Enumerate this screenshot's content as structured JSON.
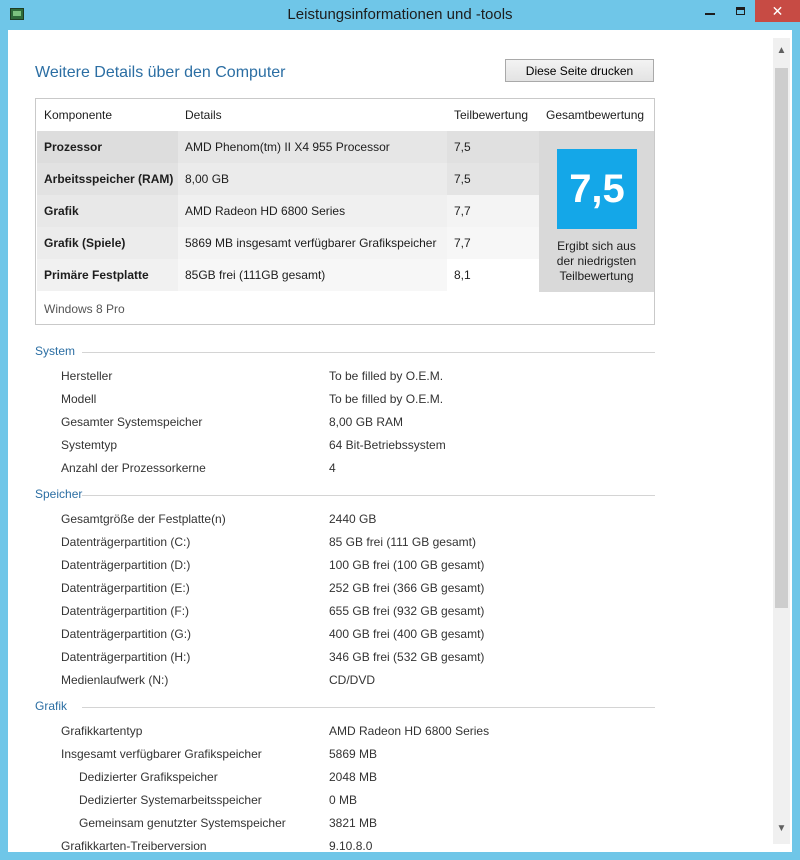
{
  "window": {
    "title": "Leistungsinformationen und -tools",
    "close_glyph": "✕"
  },
  "heading": "Weitere Details über den Computer",
  "print_button": "Diese Seite drucken",
  "scores": {
    "headers": [
      "Komponente",
      "Details",
      "Teilbewertung",
      "Gesamtbewertung"
    ],
    "rows": [
      {
        "component": "Prozessor",
        "details": "AMD Phenom(tm) II X4 955 Processor",
        "score": "7,5"
      },
      {
        "component": "Arbeitsspeicher (RAM)",
        "details": "8,00 GB",
        "score": "7,5"
      },
      {
        "component": "Grafik",
        "details": "AMD Radeon HD 6800 Series",
        "score": "7,7"
      },
      {
        "component": "Grafik (Spiele)",
        "details": "5869 MB insgesamt verfügbarer Grafikspeicher",
        "score": "7,7"
      },
      {
        "component": "Primäre Festplatte",
        "details": "85GB frei (111GB gesamt)",
        "score": "8,1"
      }
    ],
    "overall": "7,5",
    "overall_note": [
      "Ergibt sich aus",
      "der niedrigsten",
      "Teilbewertung"
    ],
    "os": "Windows 8 Pro"
  },
  "system": {
    "title": "System",
    "items": [
      {
        "label": "Hersteller",
        "value": "To be filled by O.E.M."
      },
      {
        "label": "Modell",
        "value": "To be filled by O.E.M."
      },
      {
        "label": "Gesamter Systemspeicher",
        "value": "8,00 GB RAM"
      },
      {
        "label": "Systemtyp",
        "value": "64 Bit-Betriebssystem"
      },
      {
        "label": "Anzahl der Prozessorkerne",
        "value": "4"
      }
    ]
  },
  "storage": {
    "title": "Speicher",
    "items": [
      {
        "label": "Gesamtgröße der Festplatte(n)",
        "value": "2440 GB"
      },
      {
        "label": "Datenträgerpartition (C:)",
        "value": "85 GB frei (111 GB gesamt)"
      },
      {
        "label": "Datenträgerpartition (D:)",
        "value": "100 GB frei (100 GB gesamt)"
      },
      {
        "label": "Datenträgerpartition (E:)",
        "value": "252 GB frei (366 GB gesamt)"
      },
      {
        "label": "Datenträgerpartition (F:)",
        "value": "655 GB frei (932 GB gesamt)"
      },
      {
        "label": "Datenträgerpartition (G:)",
        "value": "400 GB frei (400 GB gesamt)"
      },
      {
        "label": "Datenträgerpartition (H:)",
        "value": "346 GB frei (532 GB gesamt)"
      },
      {
        "label": "Medienlaufwerk (N:)",
        "value": "CD/DVD"
      }
    ]
  },
  "graphics": {
    "title": "Grafik",
    "items": [
      {
        "label": "Grafikkartentyp",
        "value": "AMD Radeon HD 6800 Series"
      },
      {
        "label": "Insgesamt verfügbarer Grafikspeicher",
        "value": "5869 MB"
      },
      {
        "label": "Dedizierter Grafikspeicher",
        "value": "2048 MB"
      },
      {
        "label": "Dedizierter Systemarbeitsspeicher",
        "value": "0 MB"
      },
      {
        "label": "Gemeinsam genutzter Systemspeicher",
        "value": "3821 MB"
      },
      {
        "label": "Grafikkarten-Treiberversion",
        "value": "9.10.8.0"
      }
    ]
  }
}
